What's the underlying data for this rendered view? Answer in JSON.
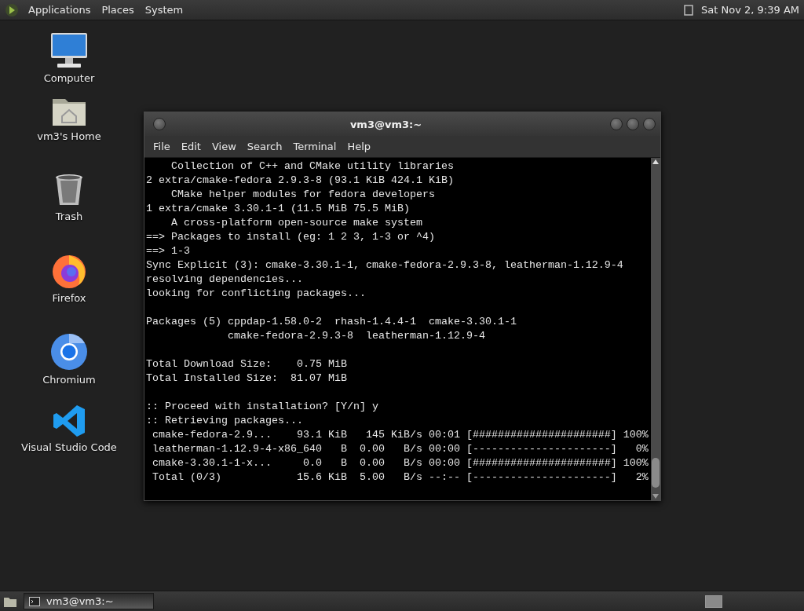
{
  "top_panel": {
    "menus": [
      "Applications",
      "Places",
      "System"
    ],
    "clock": "Sat Nov 2, 9:39 AM"
  },
  "desktop_icons": [
    {
      "kind": "computer",
      "label": "Computer"
    },
    {
      "kind": "home",
      "label": "vm3's Home"
    },
    {
      "kind": "trash",
      "label": "Trash"
    },
    {
      "kind": "firefox",
      "label": "Firefox"
    },
    {
      "kind": "chromium",
      "label": "Chromium"
    },
    {
      "kind": "vscode",
      "label": "Visual Studio Code"
    }
  ],
  "terminal": {
    "title": "vm3@vm3:~",
    "menu": [
      "File",
      "Edit",
      "View",
      "Search",
      "Terminal",
      "Help"
    ],
    "blocks": [
      [
        "    Collection of C++ and CMake utility libraries",
        "2 extra/cmake-fedora 2.9.3-8 (93.1 KiB 424.1 KiB)",
        "    CMake helper modules for fedora developers",
        "1 extra/cmake 3.30.1-1 (11.5 MiB 75.5 MiB)",
        "    A cross-platform open-source make system",
        "==> Packages to install (eg: 1 2 3, 1-3 or ^4)",
        "==> 1-3",
        "Sync Explicit (3): cmake-3.30.1-1, cmake-fedora-2.9.3-8, leatherman-1.12.9-4",
        "resolving dependencies...",
        "looking for conflicting packages..."
      ],
      [
        "Packages (5) cppdap-1.58.0-2  rhash-1.4.4-1  cmake-3.30.1-1",
        "             cmake-fedora-2.9.3-8  leatherman-1.12.9-4"
      ],
      [
        "Total Download Size:    0.75 MiB",
        "Total Installed Size:  81.07 MiB"
      ],
      [
        ":: Proceed with installation? [Y/n] y",
        ":: Retrieving packages...",
        " cmake-fedora-2.9...    93.1 KiB   145 KiB/s 00:01 [######################] 100%",
        " leatherman-1.12.9-4-x86_640   B  0.00   B/s 00:00 [----------------------]   0%",
        " cmake-3.30.1-1-x...     0.0   B  0.00   B/s 00:00 [######################] 100%",
        " Total (0/3)            15.6 KiB  5.00   B/s --:-- [----------------------]   2%"
      ]
    ]
  },
  "taskbar": {
    "windows": [
      {
        "label": "vm3@vm3:~",
        "selected": true
      }
    ],
    "workspaces": [
      {
        "selected": true
      }
    ]
  }
}
